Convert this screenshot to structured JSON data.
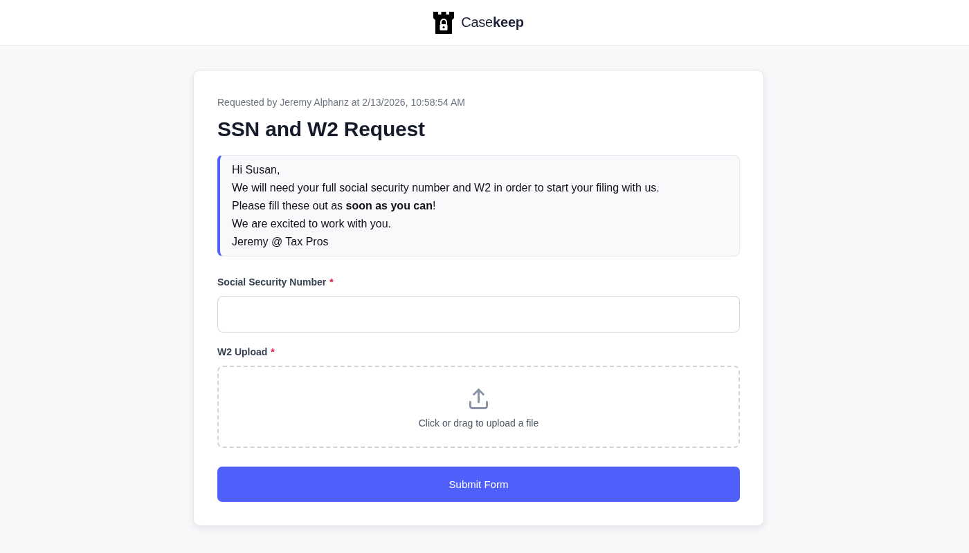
{
  "header": {
    "logo_text": "Case**keep**"
  },
  "request": {
    "meta": "Requested by Jeremy Alphanz at 2/13/2026, 10:58:54 AM",
    "title": "SSN and W2 Request",
    "message_lines": [
      "Hi Susan,",
      "We will need your full social security number and W2 in order to start your filing with us.",
      "Please fill these out as **soon as you can**!",
      "We are excited to work with you.",
      "Jeremy @ Tax Pros"
    ],
    "fields": [
      {
        "kind": "text",
        "label": "Social Security Number",
        "required_mark": "*"
      },
      {
        "kind": "upload",
        "label": "W2 Upload",
        "required_mark": "*",
        "prompt": "Click or drag to upload a file"
      }
    ],
    "submit_button": "Submit Form"
  }
}
